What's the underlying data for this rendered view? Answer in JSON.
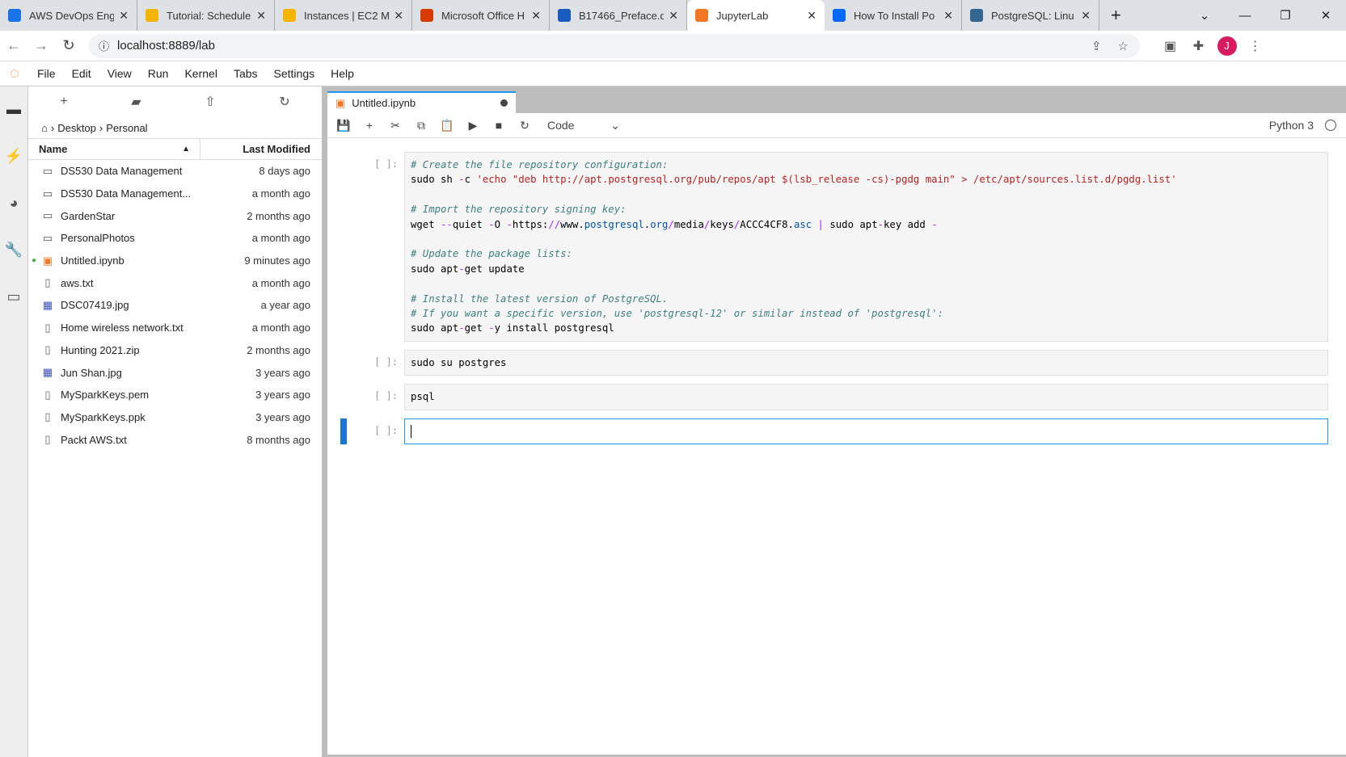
{
  "browser": {
    "tabs": [
      {
        "title": "AWS DevOps Eng",
        "color": "#1a73e8",
        "active": false
      },
      {
        "title": "Tutorial: Schedule",
        "color": "#f4b400",
        "active": false
      },
      {
        "title": "Instances | EC2 M",
        "color": "#f4b400",
        "active": false
      },
      {
        "title": "Microsoft Office H",
        "color": "#d83b01",
        "active": false
      },
      {
        "title": "B17466_Preface.d",
        "color": "#185abd",
        "active": false
      },
      {
        "title": "JupyterLab",
        "color": "#f37726",
        "active": true
      },
      {
        "title": "How To Install Po",
        "color": "#0069ff",
        "active": false
      },
      {
        "title": "PostgreSQL: Linu",
        "color": "#336791",
        "active": false
      }
    ],
    "url": "localhost:8889/lab",
    "avatar": "J"
  },
  "menu": [
    "File",
    "Edit",
    "View",
    "Run",
    "Kernel",
    "Tabs",
    "Settings",
    "Help"
  ],
  "filebrowser": {
    "breadcrumb": [
      "Desktop",
      "Personal"
    ],
    "col_name": "Name",
    "col_modified": "Last Modified",
    "files": [
      {
        "name": "DS530 Data Management",
        "modified": "8 days ago",
        "type": "folder"
      },
      {
        "name": "DS530 Data Management...",
        "modified": "a month ago",
        "type": "folder"
      },
      {
        "name": "GardenStar",
        "modified": "2 months ago",
        "type": "folder"
      },
      {
        "name": "PersonalPhotos",
        "modified": "a month ago",
        "type": "folder"
      },
      {
        "name": "Untitled.ipynb",
        "modified": "9 minutes ago",
        "type": "notebook",
        "running": true
      },
      {
        "name": "aws.txt",
        "modified": "a month ago",
        "type": "file"
      },
      {
        "name": "DSC07419.jpg",
        "modified": "a year ago",
        "type": "image"
      },
      {
        "name": "Home wireless network.txt",
        "modified": "a month ago",
        "type": "file"
      },
      {
        "name": "Hunting 2021.zip",
        "modified": "2 months ago",
        "type": "file"
      },
      {
        "name": "Jun Shan.jpg",
        "modified": "3 years ago",
        "type": "image"
      },
      {
        "name": "MySparkKeys.pem",
        "modified": "3 years ago",
        "type": "file"
      },
      {
        "name": "MySparkKeys.ppk",
        "modified": "3 years ago",
        "type": "file"
      },
      {
        "name": "Packt AWS.txt",
        "modified": "8 months ago",
        "type": "file"
      }
    ]
  },
  "notebook": {
    "tab_title": "Untitled.ipynb",
    "cell_type": "Code",
    "kernel": "Python 3",
    "prompt": "[ ]:",
    "cells": [
      {
        "lines": [
          [
            [
              "cm",
              "# Create the file repository configuration:"
            ]
          ],
          [
            [
              "",
              "sudo sh "
            ],
            [
              "op",
              "-"
            ],
            [
              "",
              "c "
            ],
            [
              "st",
              "'echo \"deb http://apt.postgresql.org/pub/repos/apt $(lsb_release -cs)-pgdg main\" > /etc/apt/sources.list.d/pgdg.list'"
            ]
          ],
          [],
          [
            [
              "cm",
              "# Import the repository signing key:"
            ]
          ],
          [
            [
              "",
              "wget "
            ],
            [
              "op",
              "--"
            ],
            [
              "",
              "quiet "
            ],
            [
              "op",
              "-"
            ],
            [
              "",
              "O "
            ],
            [
              "op",
              "-"
            ],
            [
              "",
              "https:"
            ],
            [
              "op",
              "//"
            ],
            [
              "",
              "www."
            ],
            [
              "kw",
              "postgresql"
            ],
            [
              "",
              "."
            ],
            [
              "kw",
              "org"
            ],
            [
              "op",
              "/"
            ],
            [
              "",
              "media"
            ],
            [
              "op",
              "/"
            ],
            [
              "",
              "keys"
            ],
            [
              "op",
              "/"
            ],
            [
              "",
              "ACCC4CF8."
            ],
            [
              "kw",
              "asc"
            ],
            [
              "op",
              " | "
            ],
            [
              "",
              "sudo apt"
            ],
            [
              "op",
              "-"
            ],
            [
              "",
              "key add "
            ],
            [
              "op",
              "-"
            ]
          ],
          [],
          [
            [
              "cm",
              "# Update the package lists:"
            ]
          ],
          [
            [
              "",
              "sudo apt"
            ],
            [
              "op",
              "-"
            ],
            [
              "",
              "get update"
            ]
          ],
          [],
          [
            [
              "cm",
              "# Install the latest version of PostgreSQL."
            ]
          ],
          [
            [
              "cm",
              "# If you want a specific version, use 'postgresql-12' or similar instead of 'postgresql':"
            ]
          ],
          [
            [
              "",
              "sudo apt"
            ],
            [
              "op",
              "-"
            ],
            [
              "",
              "get "
            ],
            [
              "op",
              "-"
            ],
            [
              "",
              "y install postgresql"
            ]
          ]
        ]
      },
      {
        "lines": [
          [
            [
              "",
              "sudo su postgres"
            ]
          ]
        ]
      },
      {
        "lines": [
          [
            [
              "",
              "psql"
            ]
          ]
        ]
      },
      {
        "lines": [],
        "active": true
      }
    ]
  }
}
